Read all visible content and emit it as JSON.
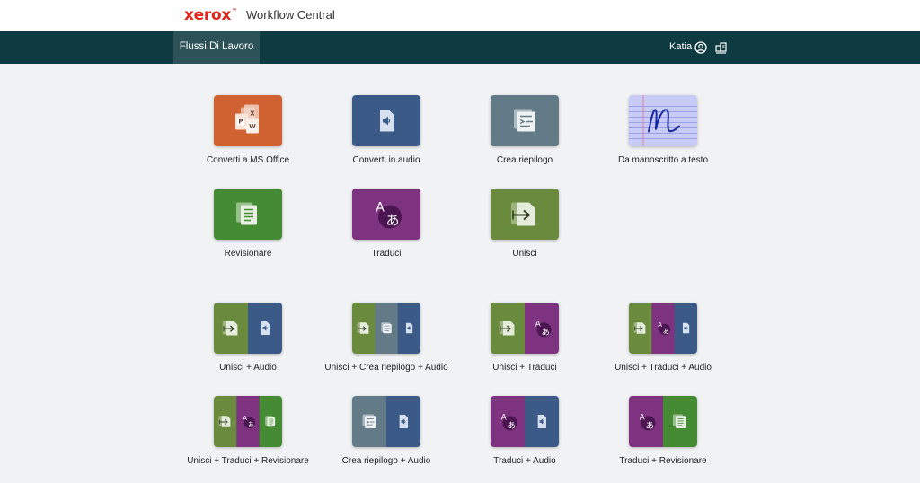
{
  "brand": {
    "logo_text": "xerox",
    "trademark": "™",
    "app_name": "Workflow Central"
  },
  "nav": {
    "active_tab": "Flussi Di Lavoro",
    "user_name": "Katia"
  },
  "icons": {
    "user": "user-circle-icon",
    "extra": "apps-icon"
  },
  "colors": {
    "nav_bg": "#0e3b41",
    "nav_active": "#2d5258",
    "office": "#d06231",
    "audio": "#3b5a88",
    "summary": "#637b87",
    "handwriting": "#c8cbf6",
    "review": "#448b34",
    "translate": "#7d3380",
    "merge": "#6a8a3e"
  },
  "workflows": [
    {
      "label": "Converti a MS Office",
      "icons": [
        "office"
      ]
    },
    {
      "label": "Converti in audio",
      "icons": [
        "audio"
      ]
    },
    {
      "label": "Crea riepilogo",
      "icons": [
        "summary"
      ]
    },
    {
      "label": "Da manoscritto a testo",
      "icons": [
        "handwriting"
      ]
    },
    {
      "label": "Revisionare",
      "icons": [
        "review"
      ]
    },
    {
      "label": "Traduci",
      "icons": [
        "translate"
      ]
    },
    {
      "label": "Unisci",
      "icons": [
        "merge"
      ]
    },
    {
      "label": "Unisci + Audio",
      "icons": [
        "merge",
        "audio"
      ]
    },
    {
      "label": "Unisci + Crea riepilogo + Audio",
      "icons": [
        "merge",
        "summary",
        "audio"
      ]
    },
    {
      "label": "Unisci + Traduci",
      "icons": [
        "merge",
        "translate"
      ]
    },
    {
      "label": "Unisci + Traduci + Audio",
      "icons": [
        "merge",
        "translate",
        "audio"
      ]
    },
    {
      "label": "Unisci + Traduci + Revisionare",
      "icons": [
        "merge",
        "translate",
        "review"
      ]
    },
    {
      "label": "Crea riepilogo + Audio",
      "icons": [
        "summary",
        "audio"
      ]
    },
    {
      "label": "Traduci + Audio",
      "icons": [
        "translate",
        "audio"
      ]
    },
    {
      "label": "Traduci + Revisionare",
      "icons": [
        "translate",
        "review"
      ]
    }
  ]
}
